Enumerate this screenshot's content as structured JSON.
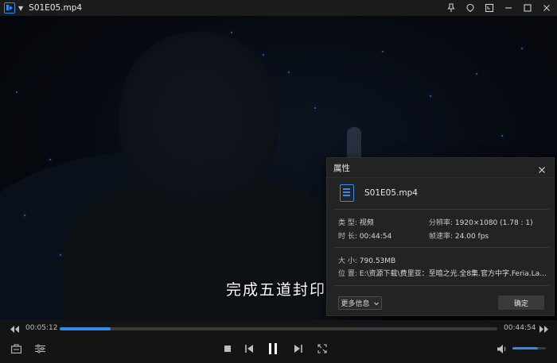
{
  "window": {
    "title": "S01E05.mp4"
  },
  "video": {
    "subtitle": "完成五道封印"
  },
  "dialog": {
    "title": "属性",
    "file_name": "S01E05.mp4",
    "type_label": "类 型:",
    "type_value": "视频",
    "resolution_label": "分辨率:",
    "resolution_value": "1920×1080 (1.78 : 1)",
    "duration_label": "时 长:",
    "duration_value": "00:44:54",
    "framerate_label": "帧速率:",
    "framerate_value": "24.00 fps",
    "size_label": "大 小:",
    "size_value": "790.53MB",
    "location_label": "位 置:",
    "location_value": "E:\\资源下载\\费里亚：至暗之光.全8集.官方中字.Feria.La...",
    "more_info_label": "更多信息",
    "ok_label": "确定"
  },
  "player": {
    "current_time": "00:05:12",
    "total_time": "00:44:54",
    "progress": 0.116,
    "volume": 0.75
  },
  "colors": {
    "accent": "#2f8bf0",
    "titlebar": "#1b1b1b",
    "dialog_bg": "#232323",
    "control_bar": "#141414"
  }
}
